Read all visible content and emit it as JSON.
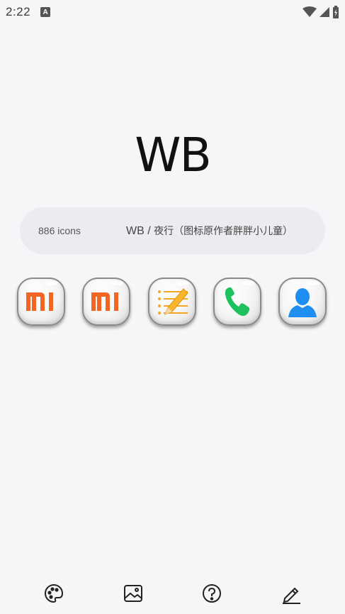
{
  "status_bar": {
    "time": "2:22",
    "notification_badge": "A"
  },
  "header": {
    "title": "WB"
  },
  "info": {
    "icon_count": "886 icons",
    "pack_name": "WB / ",
    "pack_author": "夜行（图标原作者胖胖小儿童）"
  },
  "icons": [
    {
      "name": "mi-icon",
      "color": "#f26522"
    },
    {
      "name": "mi-icon",
      "color": "#f26522"
    },
    {
      "name": "notes-icon",
      "color": "#f5a623"
    },
    {
      "name": "phone-icon",
      "color": "#1dc25f"
    },
    {
      "name": "contacts-icon",
      "color": "#1e8ef0"
    }
  ],
  "bottom_nav": [
    {
      "name": "palette-icon"
    },
    {
      "name": "wallpaper-icon"
    },
    {
      "name": "help-icon"
    },
    {
      "name": "edit-icon"
    }
  ]
}
